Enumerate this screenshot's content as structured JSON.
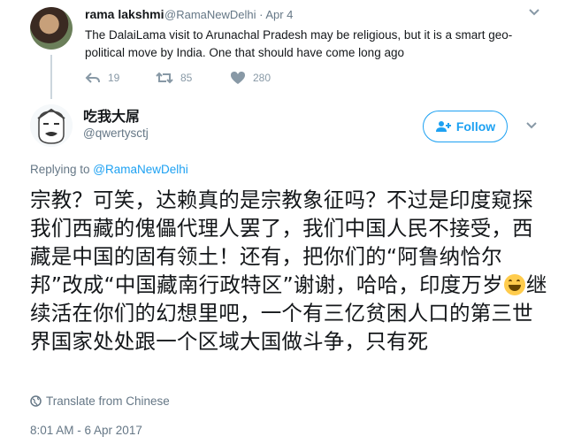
{
  "parent_tweet": {
    "name": "rama lakshmi",
    "handle_date": "@RamaNewDelhi · Apr 4",
    "text": "The DalaiLama visit to Arunachal Pradesh may be religious, but it is a smart geo-political move by India. One that should have come long ago",
    "reply_count": "19",
    "retweet_count": "85",
    "like_count": "280"
  },
  "tweet": {
    "name": "吃我大屌",
    "handle": "@qwertysctj",
    "follow_label": "Follow",
    "replying_prefix": "Replying to ",
    "replying_handle": "@RamaNewDelhi",
    "text_before_emoji": "宗教？可笑，达赖真的是宗教象征吗？不过是印度窥探我们西藏的傀儡代理人罢了，我们中国人民不接受，西藏是中国的固有领土！还有，把你们的“阿鲁纳恰尔邦”改成“中国藏南行政特区”谢谢，哈哈，印度万岁",
    "emoji": "grinning-face",
    "text_after_emoji": "继续活在你们的幻想里吧，一个有三亿贫困人口的第三世界国家处处跟一个区域大国做斗争，只有死",
    "translate_label": "Translate from Chinese",
    "timestamp": "8:01 AM - 6 Apr 2017"
  },
  "colors": {
    "accent": "#1da1f2",
    "muted": "#657786",
    "icon": "#8899a6"
  }
}
